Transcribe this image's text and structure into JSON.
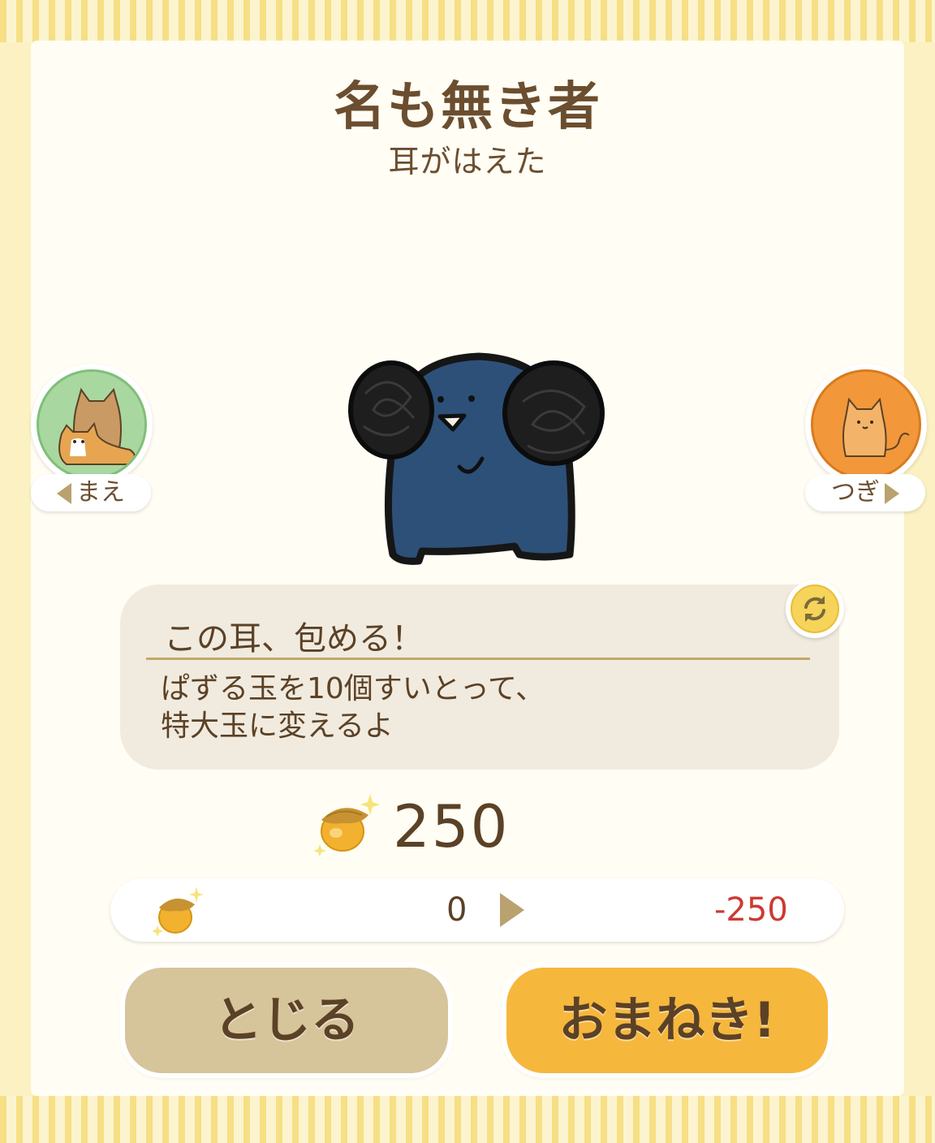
{
  "header": {
    "title": "名も無き者",
    "subtitle": "耳がはえた"
  },
  "navigation": {
    "prev_label": "まえ",
    "next_label": "つぎ"
  },
  "skill": {
    "name": "この耳、包める！",
    "description_line1": "ぱずる玉を10個すいとって、",
    "description_line2": "特大玉に変えるよ"
  },
  "cost": {
    "price": "250",
    "icon": "acorn-icon"
  },
  "balance": {
    "current": "0",
    "after": "-250"
  },
  "buttons": {
    "close_label": "とじる",
    "summon_label": "おまねき!"
  },
  "colors": {
    "text_brown": "#6b4e2f",
    "negative_red": "#cc3a32",
    "summon_button": "#f6b73d",
    "close_button": "#d6c49a",
    "character_blue": "#2d5079"
  }
}
